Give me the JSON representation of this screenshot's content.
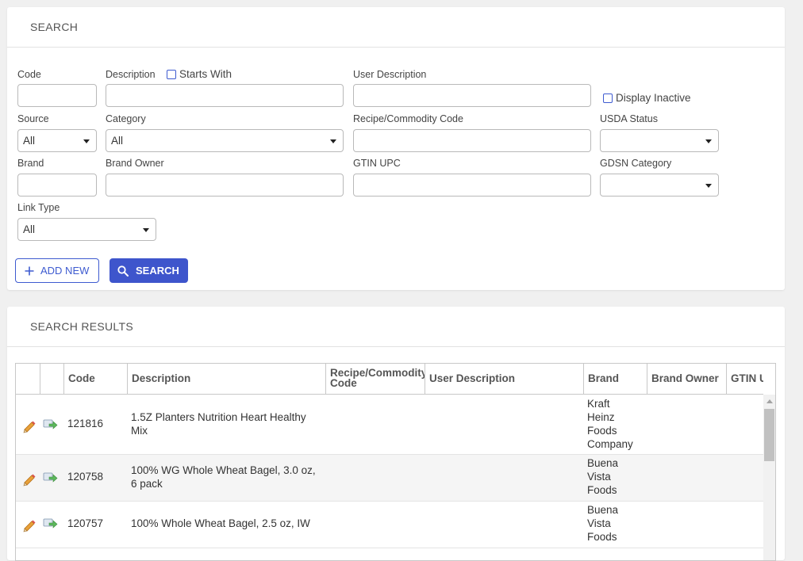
{
  "search_panel": {
    "title": "SEARCH",
    "fields": {
      "code": {
        "label": "Code",
        "value": ""
      },
      "description": {
        "label": "Description",
        "value": "",
        "starts_with_label": "Starts With"
      },
      "user_description": {
        "label": "User Description",
        "value": ""
      },
      "display_inactive_label": "Display Inactive",
      "source": {
        "label": "Source",
        "selected": "All"
      },
      "category": {
        "label": "Category",
        "selected": "All"
      },
      "recipe_commodity_code": {
        "label": "Recipe/Commodity Code",
        "value": ""
      },
      "usda_status": {
        "label": "USDA Status",
        "selected": ""
      },
      "brand": {
        "label": "Brand",
        "value": ""
      },
      "brand_owner": {
        "label": "Brand Owner",
        "value": ""
      },
      "gtin_upc": {
        "label": "GTIN UPC",
        "value": ""
      },
      "gdsn_category": {
        "label": "GDSN Category",
        "selected": ""
      },
      "link_type": {
        "label": "Link Type",
        "selected": "All"
      }
    },
    "add_new_label": "ADD NEW",
    "search_label": "SEARCH"
  },
  "results_panel": {
    "title": "SEARCH RESULTS",
    "columns": [
      "Code",
      "Description",
      "Recipe/Commodity Code",
      "User Description",
      "Brand",
      "Brand Owner",
      "GTIN UPC"
    ],
    "column_header_lines": {
      "recipe_1": "Recipe/Commodity",
      "recipe_2": "Code",
      "gtin_visible": "GTIN U"
    },
    "rows": [
      {
        "code": "121816",
        "description_1": "1.5Z Planters Nutrition Heart Healthy",
        "description_2": "Mix",
        "brand_lines": [
          "Kraft",
          "Heinz",
          "Foods",
          "Company"
        ]
      },
      {
        "code": "120758",
        "description_1": "100% WG Whole Wheat Bagel, 3.0 oz,",
        "description_2": "6 pack",
        "brand_lines": [
          "Buena",
          "Vista",
          "Foods"
        ]
      },
      {
        "code": "120757",
        "description_1": "100% Whole Wheat Bagel, 2.5 oz, IW",
        "description_2": "",
        "brand_lines": [
          "Buena",
          "Vista",
          "Foods"
        ]
      }
    ]
  },
  "icons": {
    "edit": "pencil-icon",
    "link": "link-arrow-icon",
    "add": "plus-icon",
    "search": "magnifier-icon"
  },
  "colors": {
    "accent": "#3e55cc",
    "background": "#f0f0f0",
    "panel": "#ffffff"
  }
}
